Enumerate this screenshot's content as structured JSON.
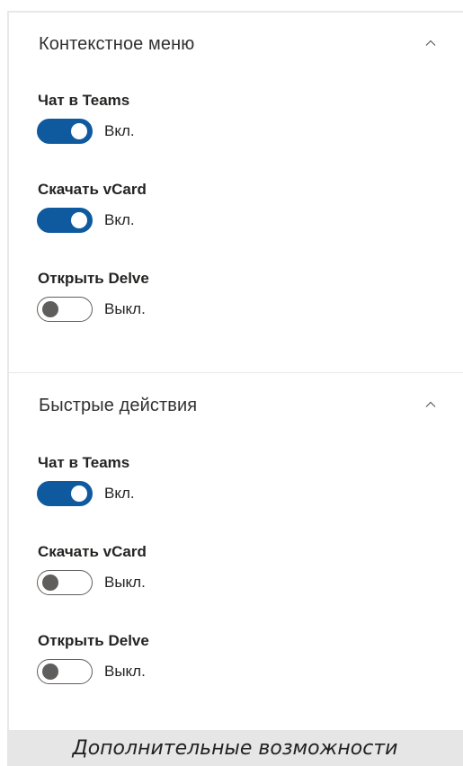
{
  "sections": [
    {
      "title": "Контекстное меню",
      "settings": [
        {
          "label": "Чат в Teams",
          "state": "Вкл.",
          "on": true
        },
        {
          "label": "Скачать vCard",
          "state": "Вкл.",
          "on": true
        },
        {
          "label": "Открыть Delve",
          "state": "Выкл.",
          "on": false
        }
      ]
    },
    {
      "title": "Быстрые действия",
      "settings": [
        {
          "label": "Чат в Teams",
          "state": "Вкл.",
          "on": true
        },
        {
          "label": "Скачать vCard",
          "state": "Выкл.",
          "on": false
        },
        {
          "label": "Открыть Delve",
          "state": "Выкл.",
          "on": false
        }
      ]
    }
  ],
  "caption": "Дополнительные возможности",
  "colors": {
    "accent": "#0f5a9e",
    "toggle_off": "#605e5c",
    "caption_bg": "#e6e6e6"
  },
  "icons": {
    "collapse": "chevron-up-icon"
  }
}
